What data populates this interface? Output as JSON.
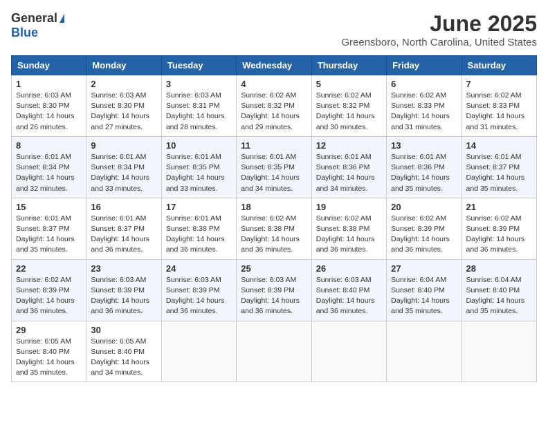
{
  "logo": {
    "general": "General",
    "blue": "Blue"
  },
  "title": "June 2025",
  "location": "Greensboro, North Carolina, United States",
  "days_of_week": [
    "Sunday",
    "Monday",
    "Tuesday",
    "Wednesday",
    "Thursday",
    "Friday",
    "Saturday"
  ],
  "weeks": [
    [
      {
        "day": 1,
        "info": "Sunrise: 6:03 AM\nSunset: 8:30 PM\nDaylight: 14 hours\nand 26 minutes."
      },
      {
        "day": 2,
        "info": "Sunrise: 6:03 AM\nSunset: 8:30 PM\nDaylight: 14 hours\nand 27 minutes."
      },
      {
        "day": 3,
        "info": "Sunrise: 6:03 AM\nSunset: 8:31 PM\nDaylight: 14 hours\nand 28 minutes."
      },
      {
        "day": 4,
        "info": "Sunrise: 6:02 AM\nSunset: 8:32 PM\nDaylight: 14 hours\nand 29 minutes."
      },
      {
        "day": 5,
        "info": "Sunrise: 6:02 AM\nSunset: 8:32 PM\nDaylight: 14 hours\nand 30 minutes."
      },
      {
        "day": 6,
        "info": "Sunrise: 6:02 AM\nSunset: 8:33 PM\nDaylight: 14 hours\nand 31 minutes."
      },
      {
        "day": 7,
        "info": "Sunrise: 6:02 AM\nSunset: 8:33 PM\nDaylight: 14 hours\nand 31 minutes."
      }
    ],
    [
      {
        "day": 8,
        "info": "Sunrise: 6:01 AM\nSunset: 8:34 PM\nDaylight: 14 hours\nand 32 minutes."
      },
      {
        "day": 9,
        "info": "Sunrise: 6:01 AM\nSunset: 8:34 PM\nDaylight: 14 hours\nand 33 minutes."
      },
      {
        "day": 10,
        "info": "Sunrise: 6:01 AM\nSunset: 8:35 PM\nDaylight: 14 hours\nand 33 minutes."
      },
      {
        "day": 11,
        "info": "Sunrise: 6:01 AM\nSunset: 8:35 PM\nDaylight: 14 hours\nand 34 minutes."
      },
      {
        "day": 12,
        "info": "Sunrise: 6:01 AM\nSunset: 8:36 PM\nDaylight: 14 hours\nand 34 minutes."
      },
      {
        "day": 13,
        "info": "Sunrise: 6:01 AM\nSunset: 8:36 PM\nDaylight: 14 hours\nand 35 minutes."
      },
      {
        "day": 14,
        "info": "Sunrise: 6:01 AM\nSunset: 8:37 PM\nDaylight: 14 hours\nand 35 minutes."
      }
    ],
    [
      {
        "day": 15,
        "info": "Sunrise: 6:01 AM\nSunset: 8:37 PM\nDaylight: 14 hours\nand 35 minutes."
      },
      {
        "day": 16,
        "info": "Sunrise: 6:01 AM\nSunset: 8:37 PM\nDaylight: 14 hours\nand 36 minutes."
      },
      {
        "day": 17,
        "info": "Sunrise: 6:01 AM\nSunset: 8:38 PM\nDaylight: 14 hours\nand 36 minutes."
      },
      {
        "day": 18,
        "info": "Sunrise: 6:02 AM\nSunset: 8:38 PM\nDaylight: 14 hours\nand 36 minutes."
      },
      {
        "day": 19,
        "info": "Sunrise: 6:02 AM\nSunset: 8:38 PM\nDaylight: 14 hours\nand 36 minutes."
      },
      {
        "day": 20,
        "info": "Sunrise: 6:02 AM\nSunset: 8:39 PM\nDaylight: 14 hours\nand 36 minutes."
      },
      {
        "day": 21,
        "info": "Sunrise: 6:02 AM\nSunset: 8:39 PM\nDaylight: 14 hours\nand 36 minutes."
      }
    ],
    [
      {
        "day": 22,
        "info": "Sunrise: 6:02 AM\nSunset: 8:39 PM\nDaylight: 14 hours\nand 36 minutes."
      },
      {
        "day": 23,
        "info": "Sunrise: 6:03 AM\nSunset: 8:39 PM\nDaylight: 14 hours\nand 36 minutes."
      },
      {
        "day": 24,
        "info": "Sunrise: 6:03 AM\nSunset: 8:39 PM\nDaylight: 14 hours\nand 36 minutes."
      },
      {
        "day": 25,
        "info": "Sunrise: 6:03 AM\nSunset: 8:39 PM\nDaylight: 14 hours\nand 36 minutes."
      },
      {
        "day": 26,
        "info": "Sunrise: 6:03 AM\nSunset: 8:40 PM\nDaylight: 14 hours\nand 36 minutes."
      },
      {
        "day": 27,
        "info": "Sunrise: 6:04 AM\nSunset: 8:40 PM\nDaylight: 14 hours\nand 35 minutes."
      },
      {
        "day": 28,
        "info": "Sunrise: 6:04 AM\nSunset: 8:40 PM\nDaylight: 14 hours\nand 35 minutes."
      }
    ],
    [
      {
        "day": 29,
        "info": "Sunrise: 6:05 AM\nSunset: 8:40 PM\nDaylight: 14 hours\nand 35 minutes."
      },
      {
        "day": 30,
        "info": "Sunrise: 6:05 AM\nSunset: 8:40 PM\nDaylight: 14 hours\nand 34 minutes."
      },
      null,
      null,
      null,
      null,
      null
    ]
  ]
}
